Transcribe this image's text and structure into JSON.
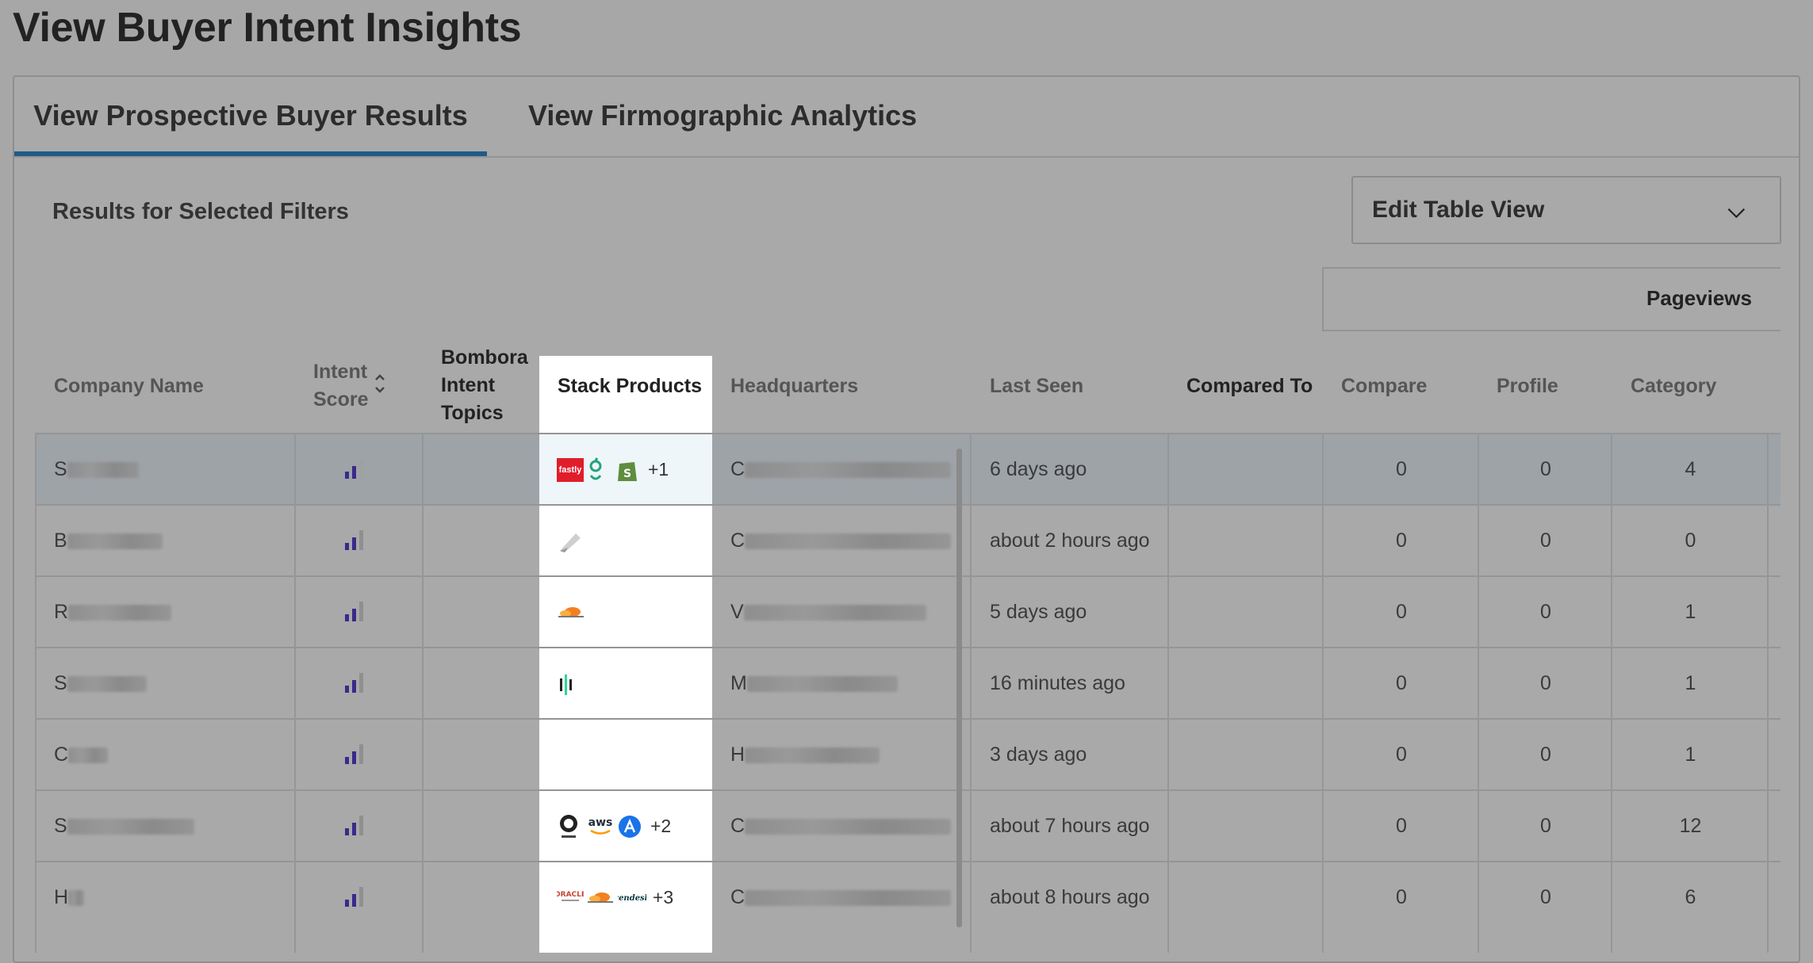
{
  "page": {
    "title": "View Buyer Intent Insights"
  },
  "tabs": [
    {
      "label": "View Prospective Buyer Results",
      "active": true
    },
    {
      "label": "View Firmographic Analytics",
      "active": false
    }
  ],
  "results_label": "Results for Selected Filters",
  "edit_table_view": {
    "label": "Edit Table View",
    "icon": "chevron-down-icon"
  },
  "table": {
    "group_header": "Pageviews",
    "headers": {
      "company": "Company Name",
      "intent_line1": "Intent",
      "intent_line2": "Score",
      "bombora_line1": "Bombora",
      "bombora_line2": "Intent",
      "bombora_line3": "Topics",
      "stack": "Stack Products",
      "hq": "Headquarters",
      "last_seen": "Last Seen",
      "compared_to": "Compared To",
      "compare": "Compare",
      "profile": "Profile",
      "category": "Category"
    },
    "rows": [
      {
        "company_initial": "S",
        "hq_initial": "C",
        "last_seen": "6 days ago",
        "compare": "0",
        "profile": "0",
        "category": "4",
        "stack_more": "+1",
        "stack_icons": [
          "fastly-logo",
          "greenhouse-logo",
          "shopify-logo"
        ],
        "selected": true
      },
      {
        "company_initial": "B",
        "hq_initial": "C",
        "last_seen": "about 2 hours ago",
        "compare": "0",
        "profile": "0",
        "category": "0",
        "stack_more": "",
        "stack_icons": [
          "pen-tool-logo"
        ]
      },
      {
        "company_initial": "R",
        "hq_initial": "V",
        "last_seen": "5 days ago",
        "compare": "0",
        "profile": "0",
        "category": "1",
        "stack_more": "",
        "stack_icons": [
          "cloudflare-logo"
        ]
      },
      {
        "company_initial": "S",
        "hq_initial": "M",
        "last_seen": "16 minutes ago",
        "compare": "0",
        "profile": "0",
        "category": "1",
        "stack_more": "",
        "stack_icons": [
          "bars-logo"
        ]
      },
      {
        "company_initial": "C",
        "hq_initial": "H",
        "last_seen": "3 days ago",
        "compare": "0",
        "profile": "0",
        "category": "1",
        "stack_more": "",
        "stack_icons": []
      },
      {
        "company_initial": "S",
        "hq_initial": "C",
        "last_seen": "about 7 hours ago",
        "compare": "0",
        "profile": "0",
        "category": "12",
        "stack_more": "+2",
        "stack_icons": [
          "mailchimp-logo",
          "aws-logo",
          "app-store-logo"
        ]
      },
      {
        "company_initial": "H",
        "hq_initial": "C",
        "last_seen": "about 8 hours ago",
        "compare": "0",
        "profile": "0",
        "category": "6",
        "stack_more": "+3",
        "stack_icons": [
          "oracle-logo",
          "cloudflare-logo",
          "zendesk-logo"
        ]
      }
    ]
  },
  "colors": {
    "tab_underline": "#1f5b8a",
    "intent_bar": "#3a2a8a",
    "fastly": "#e01e2b",
    "shopify": "#5e8e3e",
    "aws": "#232f3e",
    "cloudflare": "#f38020"
  }
}
